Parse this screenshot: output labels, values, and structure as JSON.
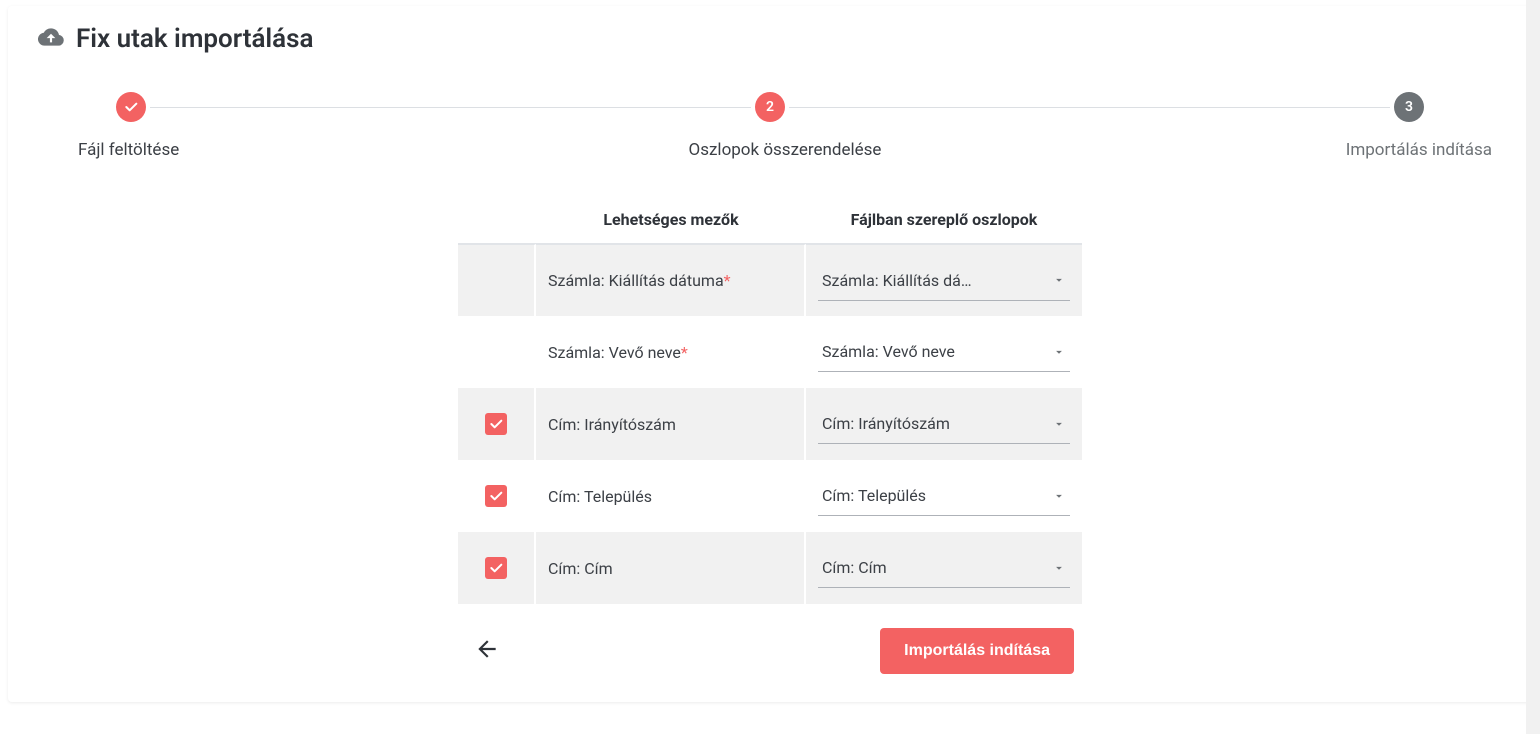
{
  "header": {
    "title": "Fix utak importálása"
  },
  "stepper": {
    "steps": [
      {
        "label": "Fájl feltöltése",
        "badge": "",
        "state": "done"
      },
      {
        "label": "Oszlopok összerendelése",
        "badge": "2",
        "state": "active"
      },
      {
        "label": "Importálás indítása",
        "badge": "3",
        "state": "pending"
      }
    ]
  },
  "table": {
    "headers": {
      "possible": "Lehetséges mezők",
      "file": "Fájlban szereplő oszlopok"
    },
    "rows": [
      {
        "checkbox": null,
        "required": true,
        "possible": "Számla: Kiállítás dátuma",
        "selected": "Számla: Kiállítás dá…"
      },
      {
        "checkbox": null,
        "required": true,
        "possible": "Számla: Vevő neve",
        "selected": "Számla: Vevő neve"
      },
      {
        "checkbox": true,
        "required": false,
        "possible": "Cím: Irányítószám",
        "selected": "Cím: Irányítószám"
      },
      {
        "checkbox": true,
        "required": false,
        "possible": "Cím: Település",
        "selected": "Cím: Település"
      },
      {
        "checkbox": true,
        "required": false,
        "possible": "Cím: Cím",
        "selected": "Cím: Cím"
      }
    ]
  },
  "footer": {
    "start_button": "Importálás indítása"
  }
}
